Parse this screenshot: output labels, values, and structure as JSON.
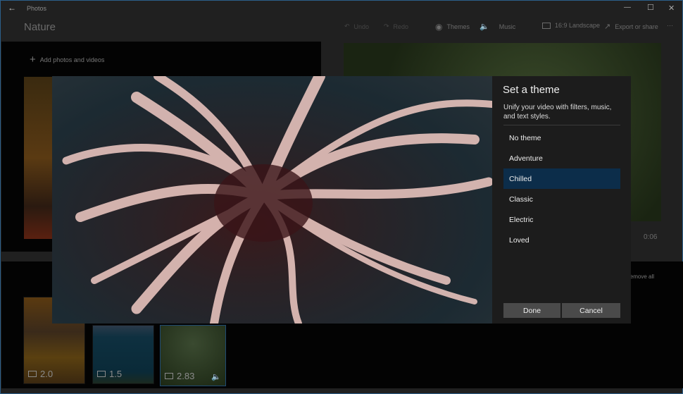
{
  "app": {
    "title": "Photos",
    "project_title": "Nature"
  },
  "window_controls": {
    "minimize": "—",
    "maximize": "☐",
    "close": "✕"
  },
  "toolbar": {
    "undo": "Undo",
    "redo": "Redo",
    "themes": "Themes",
    "music": "Music",
    "aspect": "16:9 Landscape",
    "export": "Export or share",
    "more": "···"
  },
  "library": {
    "add_label": "Add photos and videos"
  },
  "preview": {
    "time": "0:06"
  },
  "storyboard": {
    "remove_all": "Remove all",
    "items": [
      {
        "type": "image-icon",
        "duration": "2.0"
      },
      {
        "type": "image-icon",
        "duration": "1.5"
      },
      {
        "type": "video-icon",
        "duration": "2.83",
        "audio": true
      }
    ]
  },
  "dialog": {
    "title": "Set a theme",
    "description": "Unify your video with filters, music, and text styles.",
    "themes": [
      "No theme",
      "Adventure",
      "Chilled",
      "Classic",
      "Electric",
      "Loved"
    ],
    "selected": "Chilled",
    "done": "Done",
    "cancel": "Cancel",
    "accent": "#0c2d4a"
  }
}
